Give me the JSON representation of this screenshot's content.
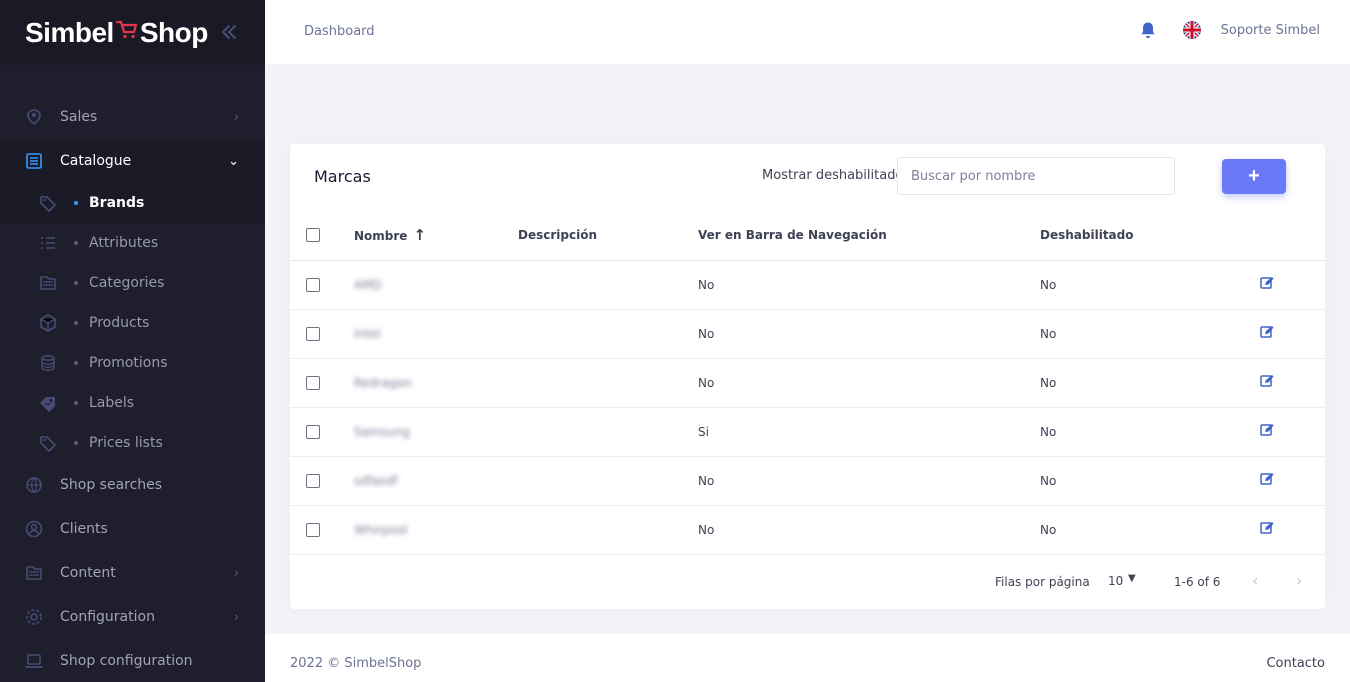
{
  "brand": {
    "name_left": "Simbel",
    "name_right": "Shop"
  },
  "sidebar": {
    "items": [
      {
        "label": "Sales",
        "icon": "sales-icon",
        "has_arrow": true
      },
      {
        "label": "Catalogue",
        "icon": "catalogue-icon",
        "expanded": true
      }
    ],
    "catalogue_sub": [
      {
        "label": "Brands",
        "icon": "tag-icon",
        "active": true
      },
      {
        "label": "Attributes",
        "icon": "list-icon"
      },
      {
        "label": "Categories",
        "icon": "folder-icon"
      },
      {
        "label": "Products",
        "icon": "box-icon"
      },
      {
        "label": "Promotions",
        "icon": "coins-icon"
      },
      {
        "label": "Labels",
        "icon": "label-icon"
      },
      {
        "label": "Prices lists",
        "icon": "price-tag-icon"
      }
    ],
    "bottom_items": [
      {
        "label": "Shop searches",
        "icon": "search-globe-icon"
      },
      {
        "label": "Clients",
        "icon": "clients-icon"
      },
      {
        "label": "Content",
        "icon": "content-icon",
        "has_arrow": true
      },
      {
        "label": "Configuration",
        "icon": "gear-icon",
        "has_arrow": true
      },
      {
        "label": "Shop configuration",
        "icon": "laptop-icon"
      }
    ]
  },
  "header": {
    "breadcrumb": "Dashboard",
    "user": "Soporte Simbel"
  },
  "card": {
    "title": "Marcas",
    "show_disabled_label": "Mostrar deshabilitados",
    "search_placeholder": "Buscar por nombre",
    "add_label": "+",
    "columns": {
      "name": "Nombre",
      "description": "Descripción",
      "nav": "Ver en Barra de Navegación",
      "disabled": "Deshabilitado"
    },
    "rows": [
      {
        "name": "AMD",
        "description": "",
        "nav": "No",
        "disabled": "No"
      },
      {
        "name": "Intel",
        "description": "",
        "nav": "No",
        "disabled": "No"
      },
      {
        "name": "Redragon",
        "description": "",
        "nav": "No",
        "disabled": "No"
      },
      {
        "name": "Samsung",
        "description": "",
        "nav": "Si",
        "disabled": "No"
      },
      {
        "name": "sdfasdf",
        "description": "",
        "nav": "No",
        "disabled": "No"
      },
      {
        "name": "Whirpool",
        "description": "",
        "nav": "No",
        "disabled": "No"
      }
    ],
    "pagination": {
      "rows_per_page_label": "Filas por página",
      "rows_per_page": "10",
      "range": "1-6 of 6"
    }
  },
  "footer": {
    "copyright": "2022 © SimbelShop",
    "contact": "Contacto"
  },
  "colors": {
    "sidebar_bg": "#1e1e2d",
    "accent": "#6979f8",
    "active_dot": "#3699ff",
    "logo_cart": "#e8344e",
    "bell": "#3f64c9"
  }
}
